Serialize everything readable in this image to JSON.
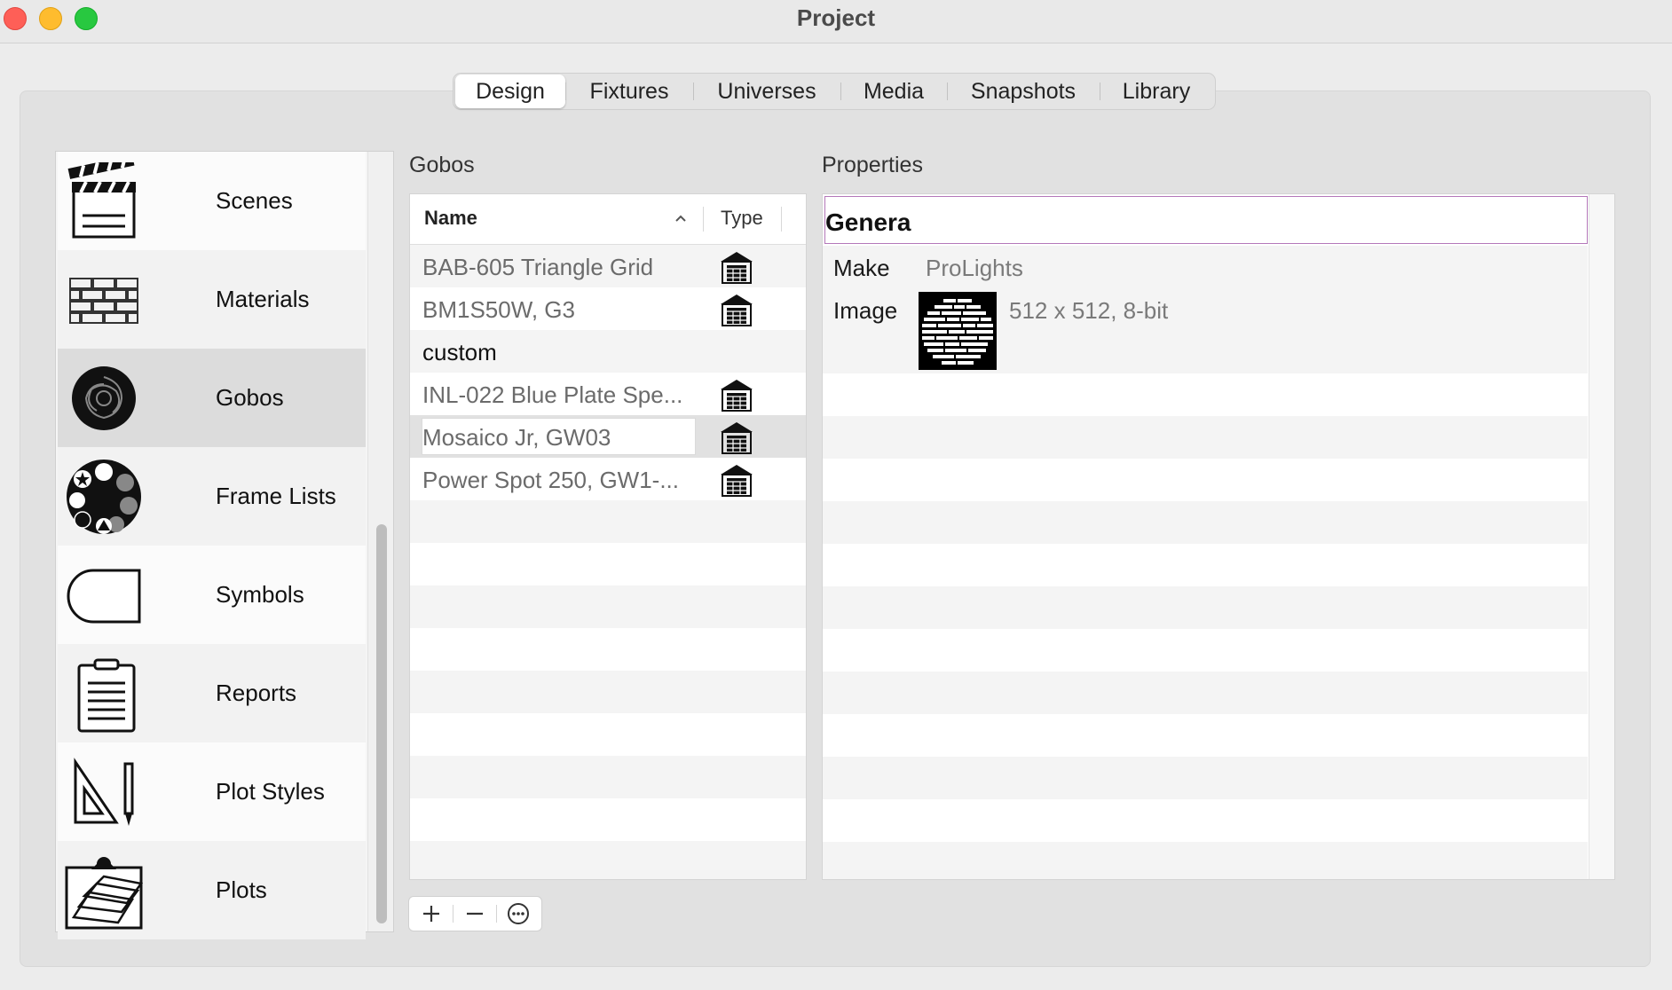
{
  "window": {
    "title": "Project"
  },
  "tabs": [
    {
      "label": "Design",
      "selected": true
    },
    {
      "label": "Fixtures",
      "selected": false
    },
    {
      "label": "Universes",
      "selected": false
    },
    {
      "label": "Media",
      "selected": false
    },
    {
      "label": "Snapshots",
      "selected": false
    },
    {
      "label": "Library",
      "selected": false
    }
  ],
  "sidebar": {
    "items": [
      {
        "label": "Scenes",
        "icon": "clapperboard-icon"
      },
      {
        "label": "Materials",
        "icon": "bricks-icon"
      },
      {
        "label": "Gobos",
        "icon": "gobo-icon",
        "selected": true
      },
      {
        "label": "Frame Lists",
        "icon": "gobo-wheel-icon"
      },
      {
        "label": "Symbols",
        "icon": "symbol-shape-icon"
      },
      {
        "label": "Reports",
        "icon": "clipboard-icon"
      },
      {
        "label": "Plot Styles",
        "icon": "set-square-pen-icon"
      },
      {
        "label": "Plots",
        "icon": "plot-sheets-icon"
      }
    ]
  },
  "gobos": {
    "section_label": "Gobos",
    "columns": {
      "name": "Name",
      "type": "Type"
    },
    "rows": [
      {
        "name": "BAB-605 Triangle Grid",
        "type_icon": "library-icon"
      },
      {
        "name": "BM1S50W, G3",
        "type_icon": "library-icon"
      },
      {
        "name": "custom",
        "type_icon": ""
      },
      {
        "name": "INL-022 Blue Plate Spe...",
        "type_icon": "library-icon"
      },
      {
        "name": "Mosaico Jr, GW03",
        "type_icon": "library-icon",
        "selected": true
      },
      {
        "name": "Power Spot 250, GW1-...",
        "type_icon": "library-icon"
      }
    ],
    "buttons": {
      "add": "plus-icon",
      "remove": "minus-icon",
      "more": "ellipsis-circle-icon"
    }
  },
  "properties": {
    "section_label": "Properties",
    "group_title": "Genera",
    "make_label": "Make",
    "make_value": "ProLights",
    "image_label": "Image",
    "image_value": "512 x 512, 8-bit"
  }
}
